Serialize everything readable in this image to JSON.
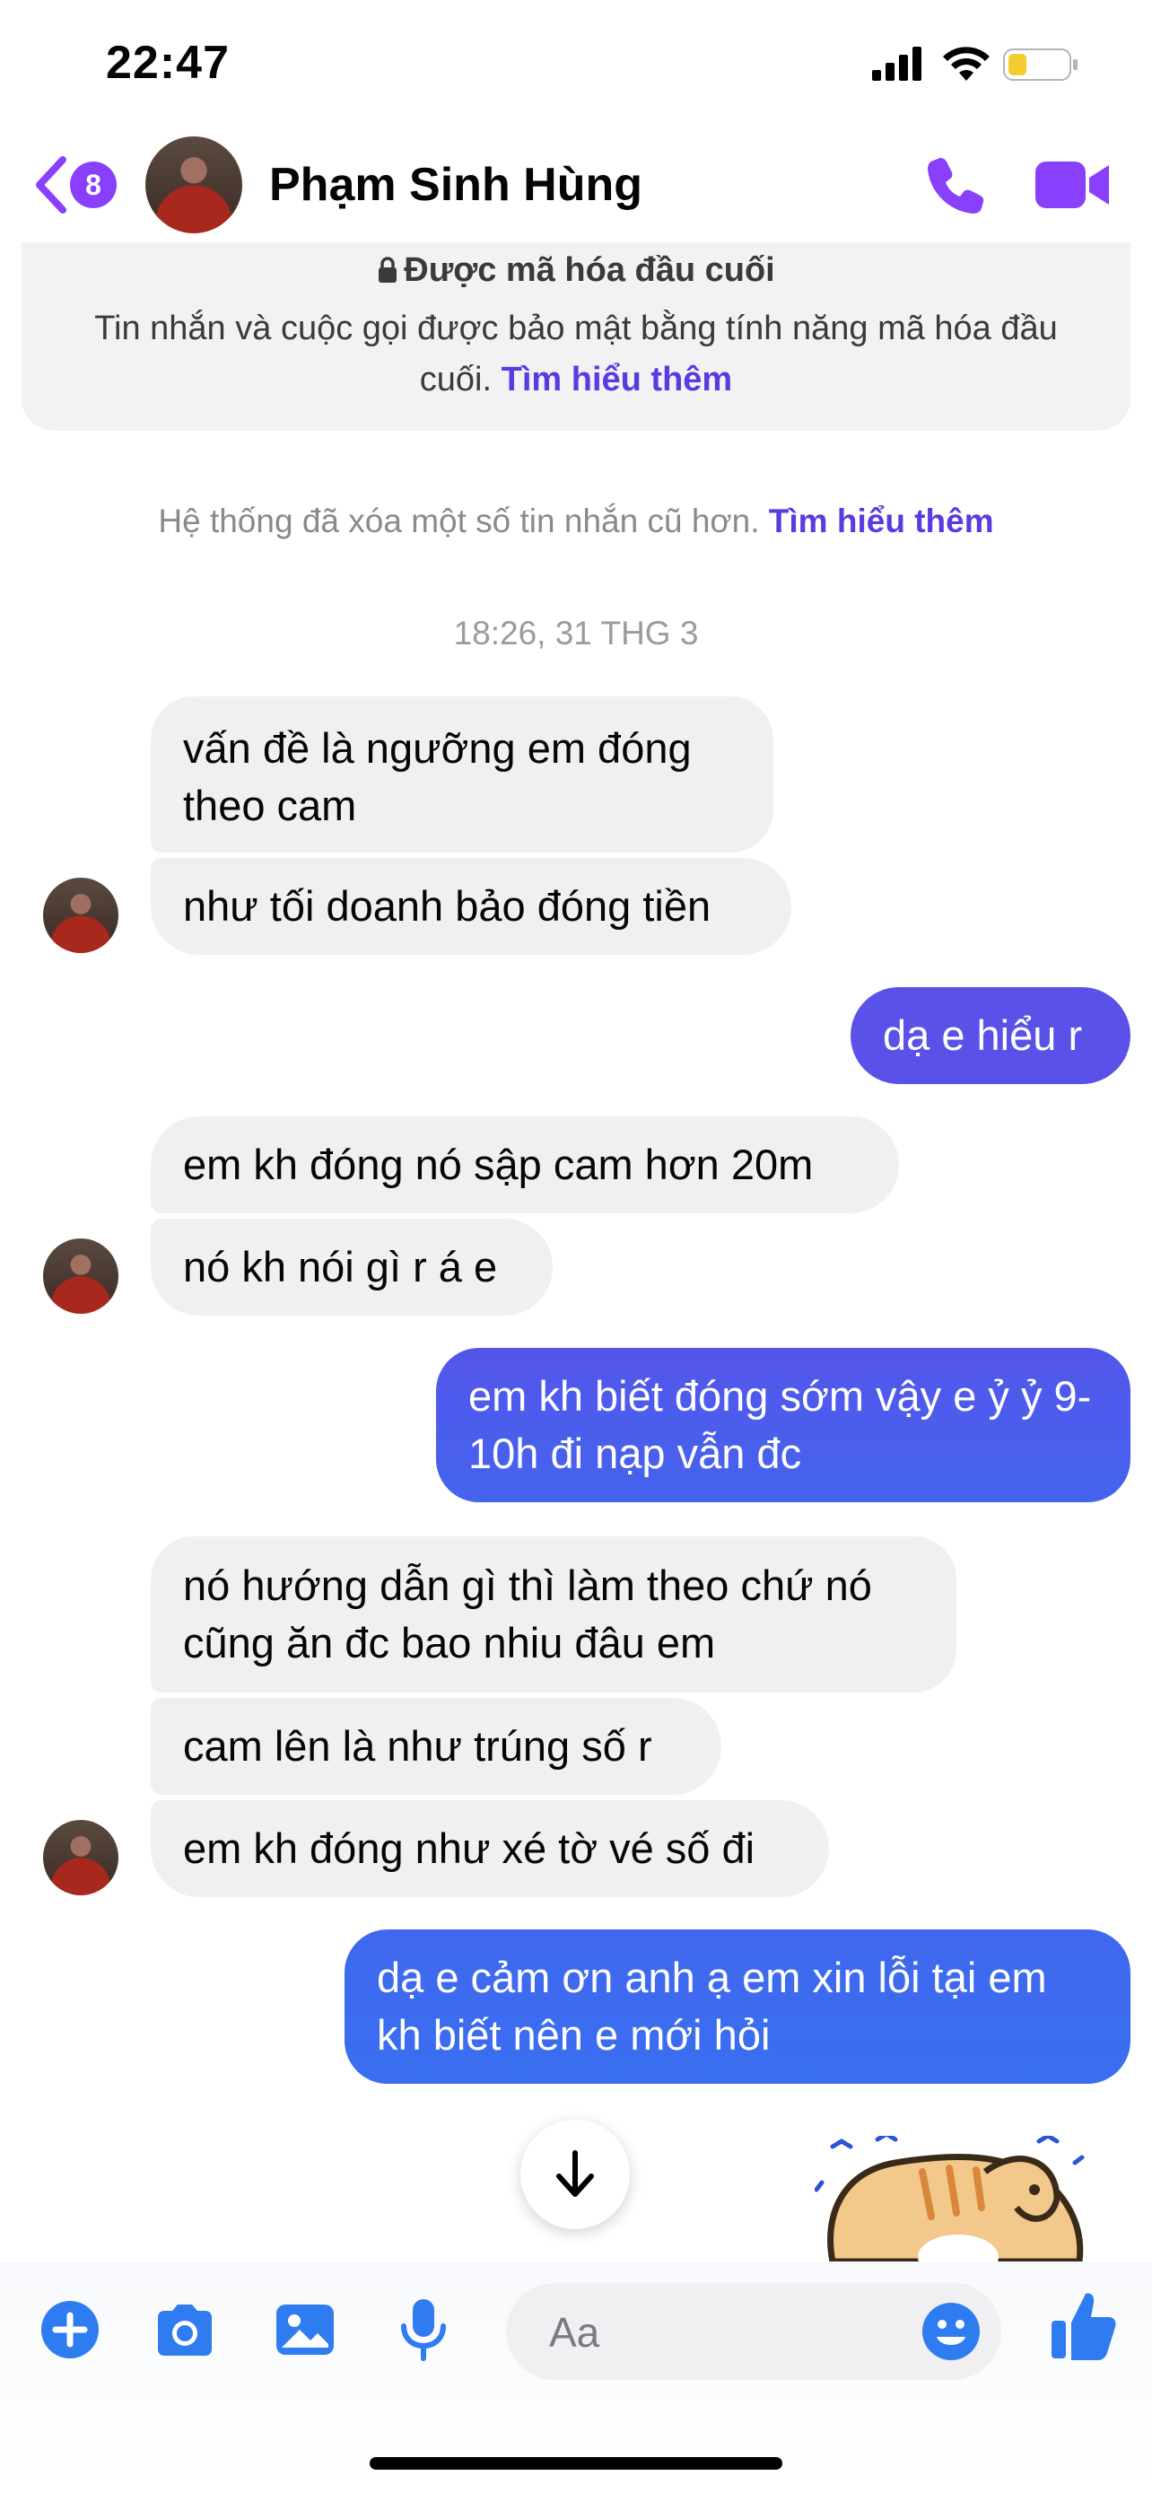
{
  "status_bar": {
    "time": "22:47"
  },
  "header": {
    "unread_count": "8",
    "contact_name": "Phạm Sinh Hùng",
    "icons": [
      "back-icon",
      "phone-icon",
      "video-camera-icon"
    ]
  },
  "encryption": {
    "title": "Được mã hóa đầu cuối",
    "body": "Tin nhắn và cuộc gọi được bảo mật bằng tính năng mã hóa đầu cuối.",
    "link": "Tìm hiểu thêm"
  },
  "system_note": {
    "text": "Hệ thống đã xóa một số tin nhắn cũ hơn.",
    "link": "Tìm hiểu thêm"
  },
  "timestamp": "18:26, 31 THG 3",
  "messages": [
    {
      "dir": "in",
      "text": "vấn đề là ngưỡng em đóng theo cam"
    },
    {
      "dir": "in",
      "text": "như tối doanh bảo đóng tiền"
    },
    {
      "dir": "out",
      "text": "dạ e hiểu r"
    },
    {
      "dir": "in",
      "text": "em kh đóng nó sập cam hơn 20m"
    },
    {
      "dir": "in",
      "text": "nó kh nói gì r á e"
    },
    {
      "dir": "out",
      "text": "em kh biết đóng sớm vậy e ỷ ỷ 9-10h đi nạp vẫn đc"
    },
    {
      "dir": "in",
      "text": "nó hướng dẫn gì thì làm theo chứ nó cũng ăn đc bao nhiu đâu em"
    },
    {
      "dir": "in",
      "text": "cam lên là như trúng số r"
    },
    {
      "dir": "in",
      "text": "em kh đóng như xé tờ vé số đi"
    },
    {
      "dir": "out",
      "text": "dạ e cảm ơn anh ạ em xin lỗi tại em kh biết nên e mới hỏi"
    }
  ],
  "composer": {
    "placeholder": "Aa",
    "icons": [
      "plus-icon",
      "camera-icon",
      "image-icon",
      "microphone-icon",
      "emoji-icon",
      "thumbs-up-icon"
    ]
  },
  "colors": {
    "accent": "#8a3ffc",
    "bubble_out_top": "#5a52e8",
    "bubble_out_bottom": "#3f67ee",
    "bubble_in": "#f0f0f0"
  }
}
